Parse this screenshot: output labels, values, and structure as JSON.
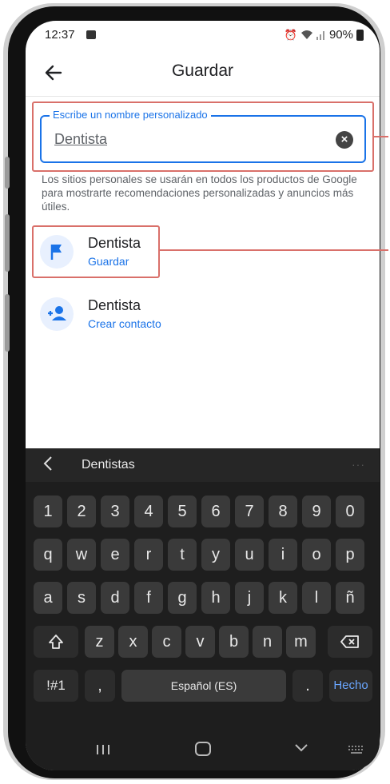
{
  "status_bar": {
    "time": "12:37",
    "battery": "90%"
  },
  "app_bar": {
    "title": "Guardar"
  },
  "name_field": {
    "label": "Escribe un nombre personalizado",
    "value": "Dentista"
  },
  "helper_text": "Los sitios personales se usarán en todos los productos de Google para mostrarte recomendaciones personalizadas y anuncios más útiles.",
  "options": [
    {
      "title": "Dentista",
      "action": "Guardar",
      "icon": "flag-icon"
    },
    {
      "title": "Dentista",
      "action": "Crear contacto",
      "icon": "add-person-icon"
    }
  ],
  "keyboard": {
    "suggestion": "Dentistas",
    "number_row": [
      "1",
      "2",
      "3",
      "4",
      "5",
      "6",
      "7",
      "8",
      "9",
      "0"
    ],
    "row1": [
      "q",
      "w",
      "e",
      "r",
      "t",
      "y",
      "u",
      "i",
      "o",
      "p"
    ],
    "row2": [
      "a",
      "s",
      "d",
      "f",
      "g",
      "h",
      "j",
      "k",
      "l",
      "ñ"
    ],
    "row3": [
      "z",
      "x",
      "c",
      "v",
      "b",
      "n",
      "m"
    ],
    "symbols_label": "!#1",
    "comma_label": ",",
    "space_label": "Español (ES)",
    "period_label": ".",
    "done_label": "Hecho"
  },
  "colors": {
    "accent": "#1a73e8",
    "annotation": "#d9706a",
    "keyboard_bg": "#1e1e1e",
    "key_bg": "#3a3a3a"
  }
}
